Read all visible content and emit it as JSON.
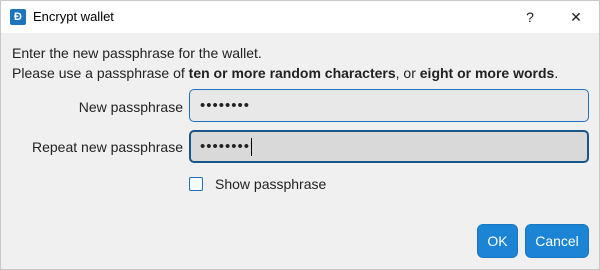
{
  "window": {
    "title": "Encrypt wallet",
    "app_icon_glyph": "Đ",
    "help_glyph": "?",
    "close_glyph": "✕"
  },
  "description": {
    "line1": "Enter the new passphrase for the wallet.",
    "line2_prefix": "Please use a passphrase of ",
    "line2_bold1": "ten or more random characters",
    "line2_middle": ", or ",
    "line2_bold2": "eight or more words",
    "line2_suffix": "."
  },
  "form": {
    "new_label": "New passphrase",
    "new_value": "••••••••",
    "repeat_label": "Repeat new passphrase",
    "repeat_value": "••••••••",
    "show_label": "Show passphrase",
    "show_checked": false
  },
  "buttons": {
    "ok": "OK",
    "cancel": "Cancel"
  },
  "colors": {
    "accent": "#1c84d4",
    "focus_border": "#19578a"
  }
}
